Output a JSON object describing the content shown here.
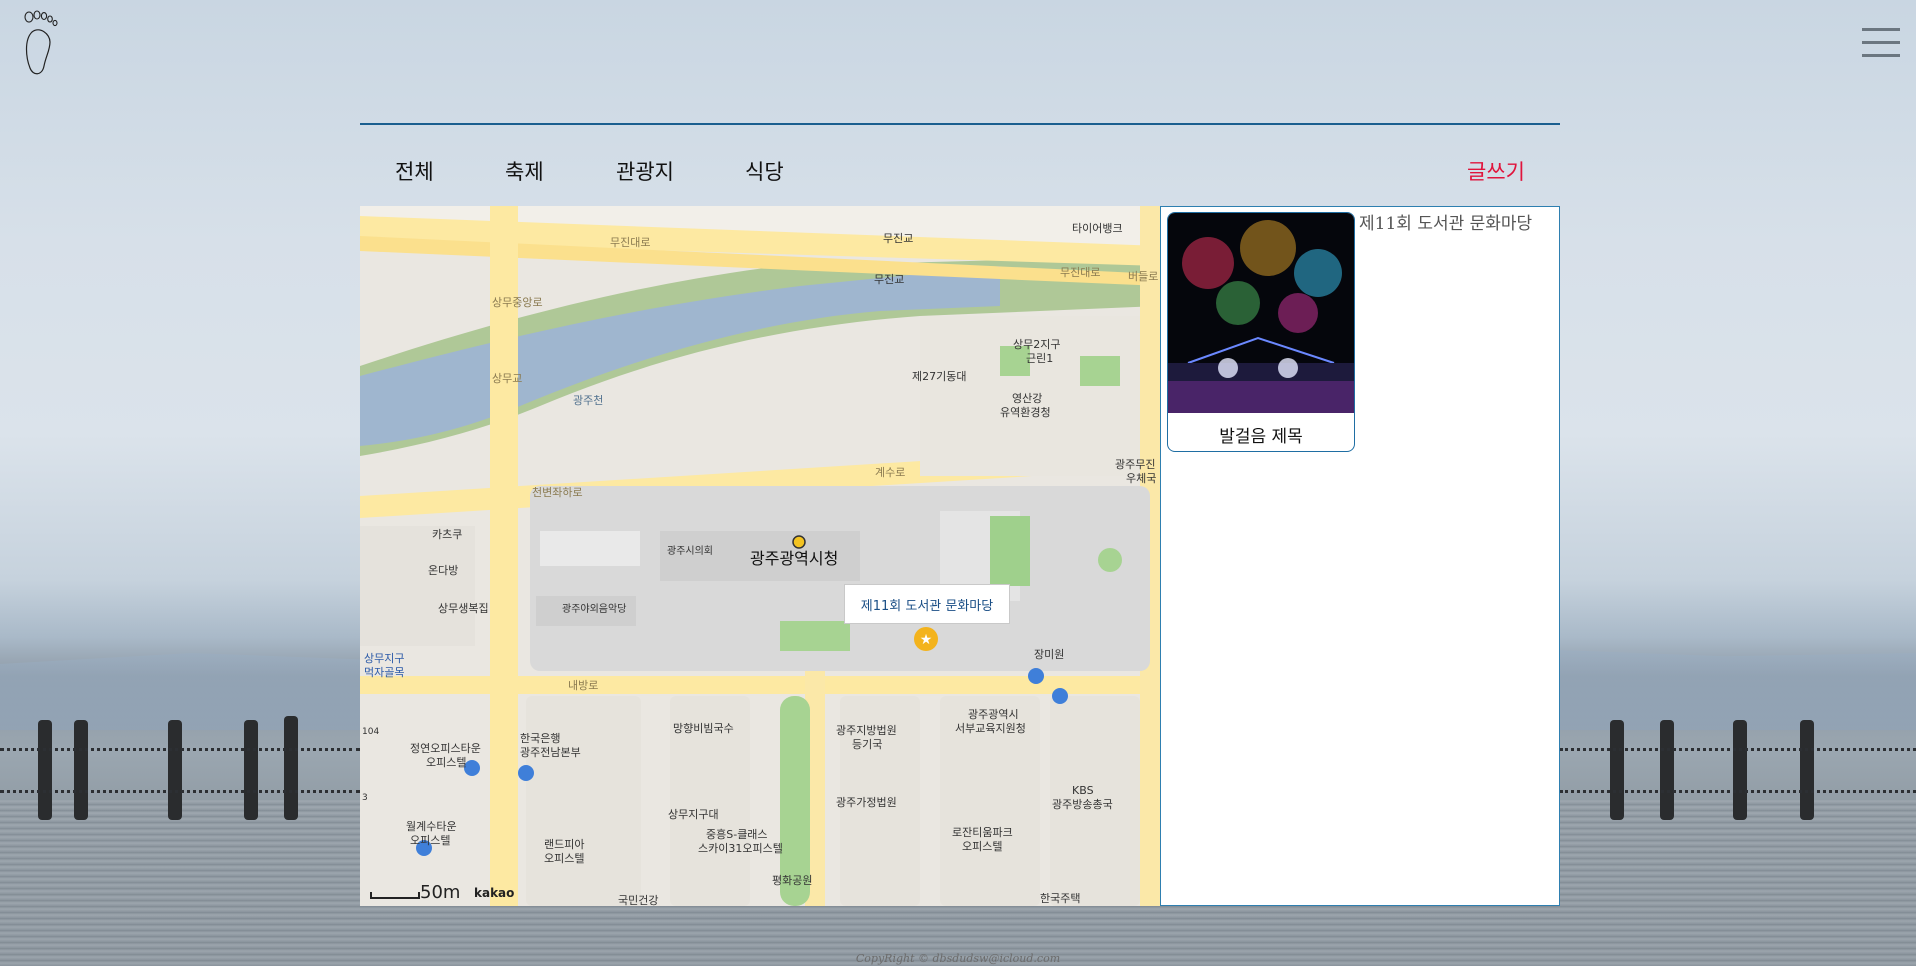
{
  "nav": {
    "tabs": [
      {
        "label": "전체"
      },
      {
        "label": "축제"
      },
      {
        "label": "관광지"
      },
      {
        "label": "식당"
      }
    ],
    "write_label": "글쓰기"
  },
  "map": {
    "labels": {
      "bridge1": "무진교",
      "bridge2": "무진교",
      "road_mujin1": "무진대로",
      "road_mujin2": "무진대로",
      "tire": "타이어뱅크",
      "beodeul": "버들로",
      "sangmu_bridge": "상무교",
      "sangmu_road": "상무중앙로",
      "gwangjucheon": "광주천",
      "jesu": "계수로",
      "cheonbyeon": "천변좌하로",
      "sangmu2": "상무2지구",
      "park1": "근린1",
      "dong27": "제27기동대",
      "yeongsan1": "영산강",
      "yeongsan2": "유역환경청",
      "post1": "광주무진",
      "post2": "우체국",
      "katsu": "카츠쿠",
      "ondabang": "온다방",
      "bokjip": "상무생복집",
      "council": "광주시의회",
      "cityhall": "광주광역시청",
      "concert": "광주야외음악당",
      "sangmu_food1": "상무지구",
      "sangmu_food2": "먹자골목",
      "jangmi": "장미원",
      "naebang": "내방로",
      "bibim": "망향비빔국수",
      "bank1": "한국은행",
      "bank2": "광주전남본부",
      "court1": "광주지방법원",
      "court2": "등기국",
      "edu1": "광주광역시",
      "edu2": "서부교육지원청",
      "jeongyeon1": "정연오피스타운",
      "jeongyeon2": "오피스텔",
      "family_court": "광주가정법원",
      "kbs1": "KBS",
      "kbs2": "광주방송총국",
      "sangmu_office": "상무지구대",
      "sclass1": "중흥S-클래스",
      "sclass2": "스카이31오피스텔",
      "wolgye1": "월계수타운",
      "wolgye2": "오피스텔",
      "landpia1": "랜드피아",
      "landpia2": "오피스텔",
      "lozan1": "로잔티움파크",
      "lozan2": "오피스텔",
      "peace": "평화공원",
      "gukmin": "국민건강",
      "hanguk": "한국주택",
      "n104": "104",
      "n3": "3"
    },
    "info_window": "제11회 도서관 문화마당",
    "scale": "50m",
    "provider": "kakao"
  },
  "panel": {
    "card_title": "발걸음 제목",
    "post_title": "제11회 도서관 문화마당"
  },
  "footer": "CopyRight © dbsdudsw@icloud.com",
  "colors": {
    "accent_line": "#1a5e8f",
    "write": "#e0143c",
    "panel_border": "#2e7fb0"
  }
}
